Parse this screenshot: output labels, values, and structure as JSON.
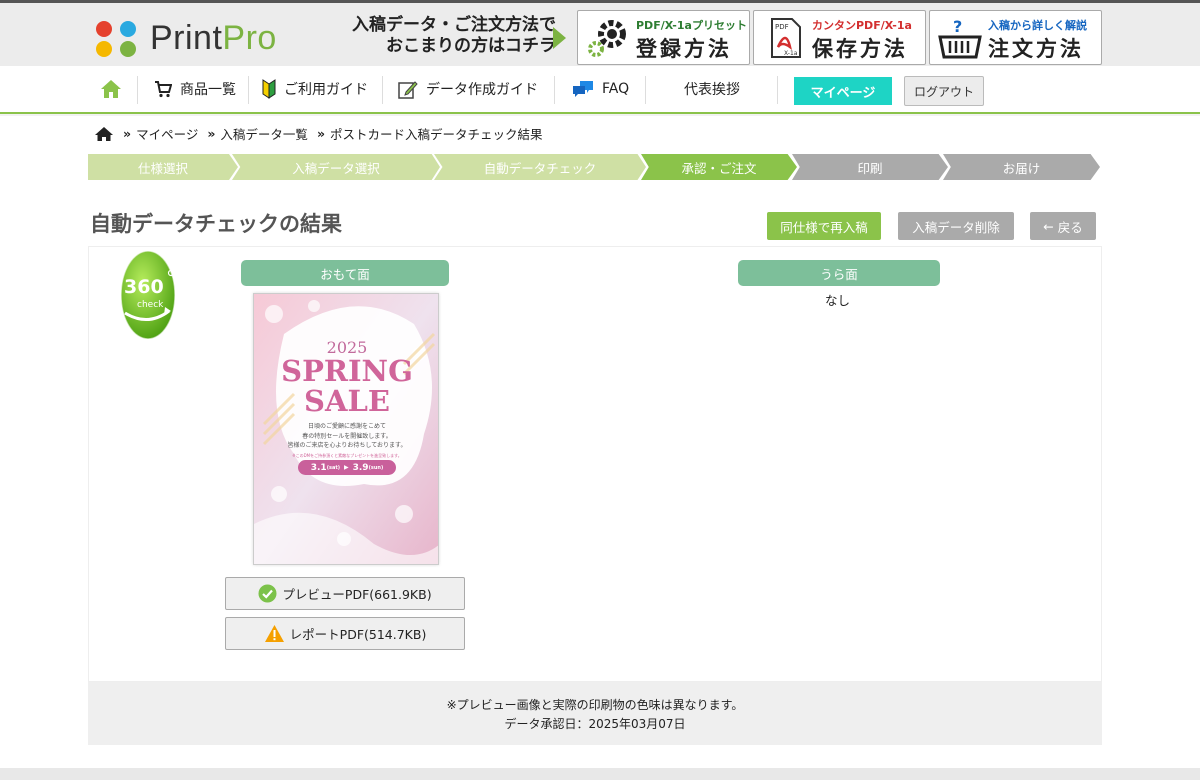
{
  "logo": {
    "brand_print": "Print",
    "brand_pro": "Pro",
    "dot_colors": [
      "#e5412d",
      "#2aa9e0",
      "#f5b800",
      "#7cb342"
    ]
  },
  "header": {
    "guide_line1": "入稿データ・ご注文方法で",
    "guide_line2": "おこまりの方はコチラ",
    "buttons": [
      {
        "sub": "PDF/X-1aプリセット",
        "main": "登録方法",
        "icon": "gear-icon",
        "sub_color": "#2e7d32"
      },
      {
        "sub": "カンタンPDF/X-1a",
        "main": "保存方法",
        "icon": "pdf-file-icon",
        "sub_color": "#d32f2f"
      },
      {
        "sub": "入稿から詳しく解説",
        "main": "注文方法",
        "icon": "basket-question-icon",
        "sub_color": "#1565c0"
      }
    ]
  },
  "nav": {
    "items": [
      {
        "label": "商品一覧",
        "icon": "cart-icon"
      },
      {
        "label": "ご利用ガイド",
        "icon": "beginner-mark-icon"
      },
      {
        "label": "データ作成ガイド",
        "icon": "edit-icon"
      },
      {
        "label": "FAQ",
        "icon": "chat-icon"
      },
      {
        "label": "代表挨拶",
        "icon": ""
      }
    ],
    "mypage": "マイページ",
    "logout": "ログアウト"
  },
  "breadcrumb": [
    "マイページ",
    "入稿データ一覧",
    "ポストカード入稿データチェック結果"
  ],
  "steps": [
    {
      "label": "仕様選択",
      "state": "done"
    },
    {
      "label": "入稿データ選択",
      "state": "done"
    },
    {
      "label": "自動データチェック",
      "state": "done"
    },
    {
      "label": "承認・ご注文",
      "state": "current"
    },
    {
      "label": "印刷",
      "state": "todo"
    },
    {
      "label": "お届け",
      "state": "todo"
    }
  ],
  "colors": {
    "step_done": "#cfe0a4",
    "step_current": "#8bc34a",
    "step_todo": "#aaaaaa",
    "accent_green": "#8bc34a",
    "teal": "#1ed4c5",
    "side_head": "#7dbf9a"
  },
  "page": {
    "title": "自動データチェックの結果",
    "reorder_button": "同仕様で再入稿",
    "delete_button": "入稿データ削除",
    "back_button": "戻る"
  },
  "result": {
    "badge_number": "360",
    "badge_word": "check",
    "front_label": "おもて面",
    "back_label": "うら面",
    "back_value": "なし",
    "preview_button": "プレビューPDF(661.9KB)",
    "report_button": "レポートPDF(514.7KB)"
  },
  "postcard": {
    "year": "2025",
    "headline1": "SPRING",
    "headline2": "SALE",
    "body1": "日頃のご愛顧に感謝をこめて",
    "body2": "春の特別セールを開催致します。",
    "body3": "皆様のご来店を心よりお待ちしております。",
    "fine": "※このDMをご持参頂くと素敵なプレゼントを進呈致します。",
    "start": "3.1",
    "start_day": "(sat)",
    "end": "3.9",
    "end_day": "(sun)"
  },
  "notes": {
    "disclaimer": "※プレビュー画像と実際の印刷物の色味は異なります。",
    "approved": "データ承認日：2025年03月07日"
  }
}
